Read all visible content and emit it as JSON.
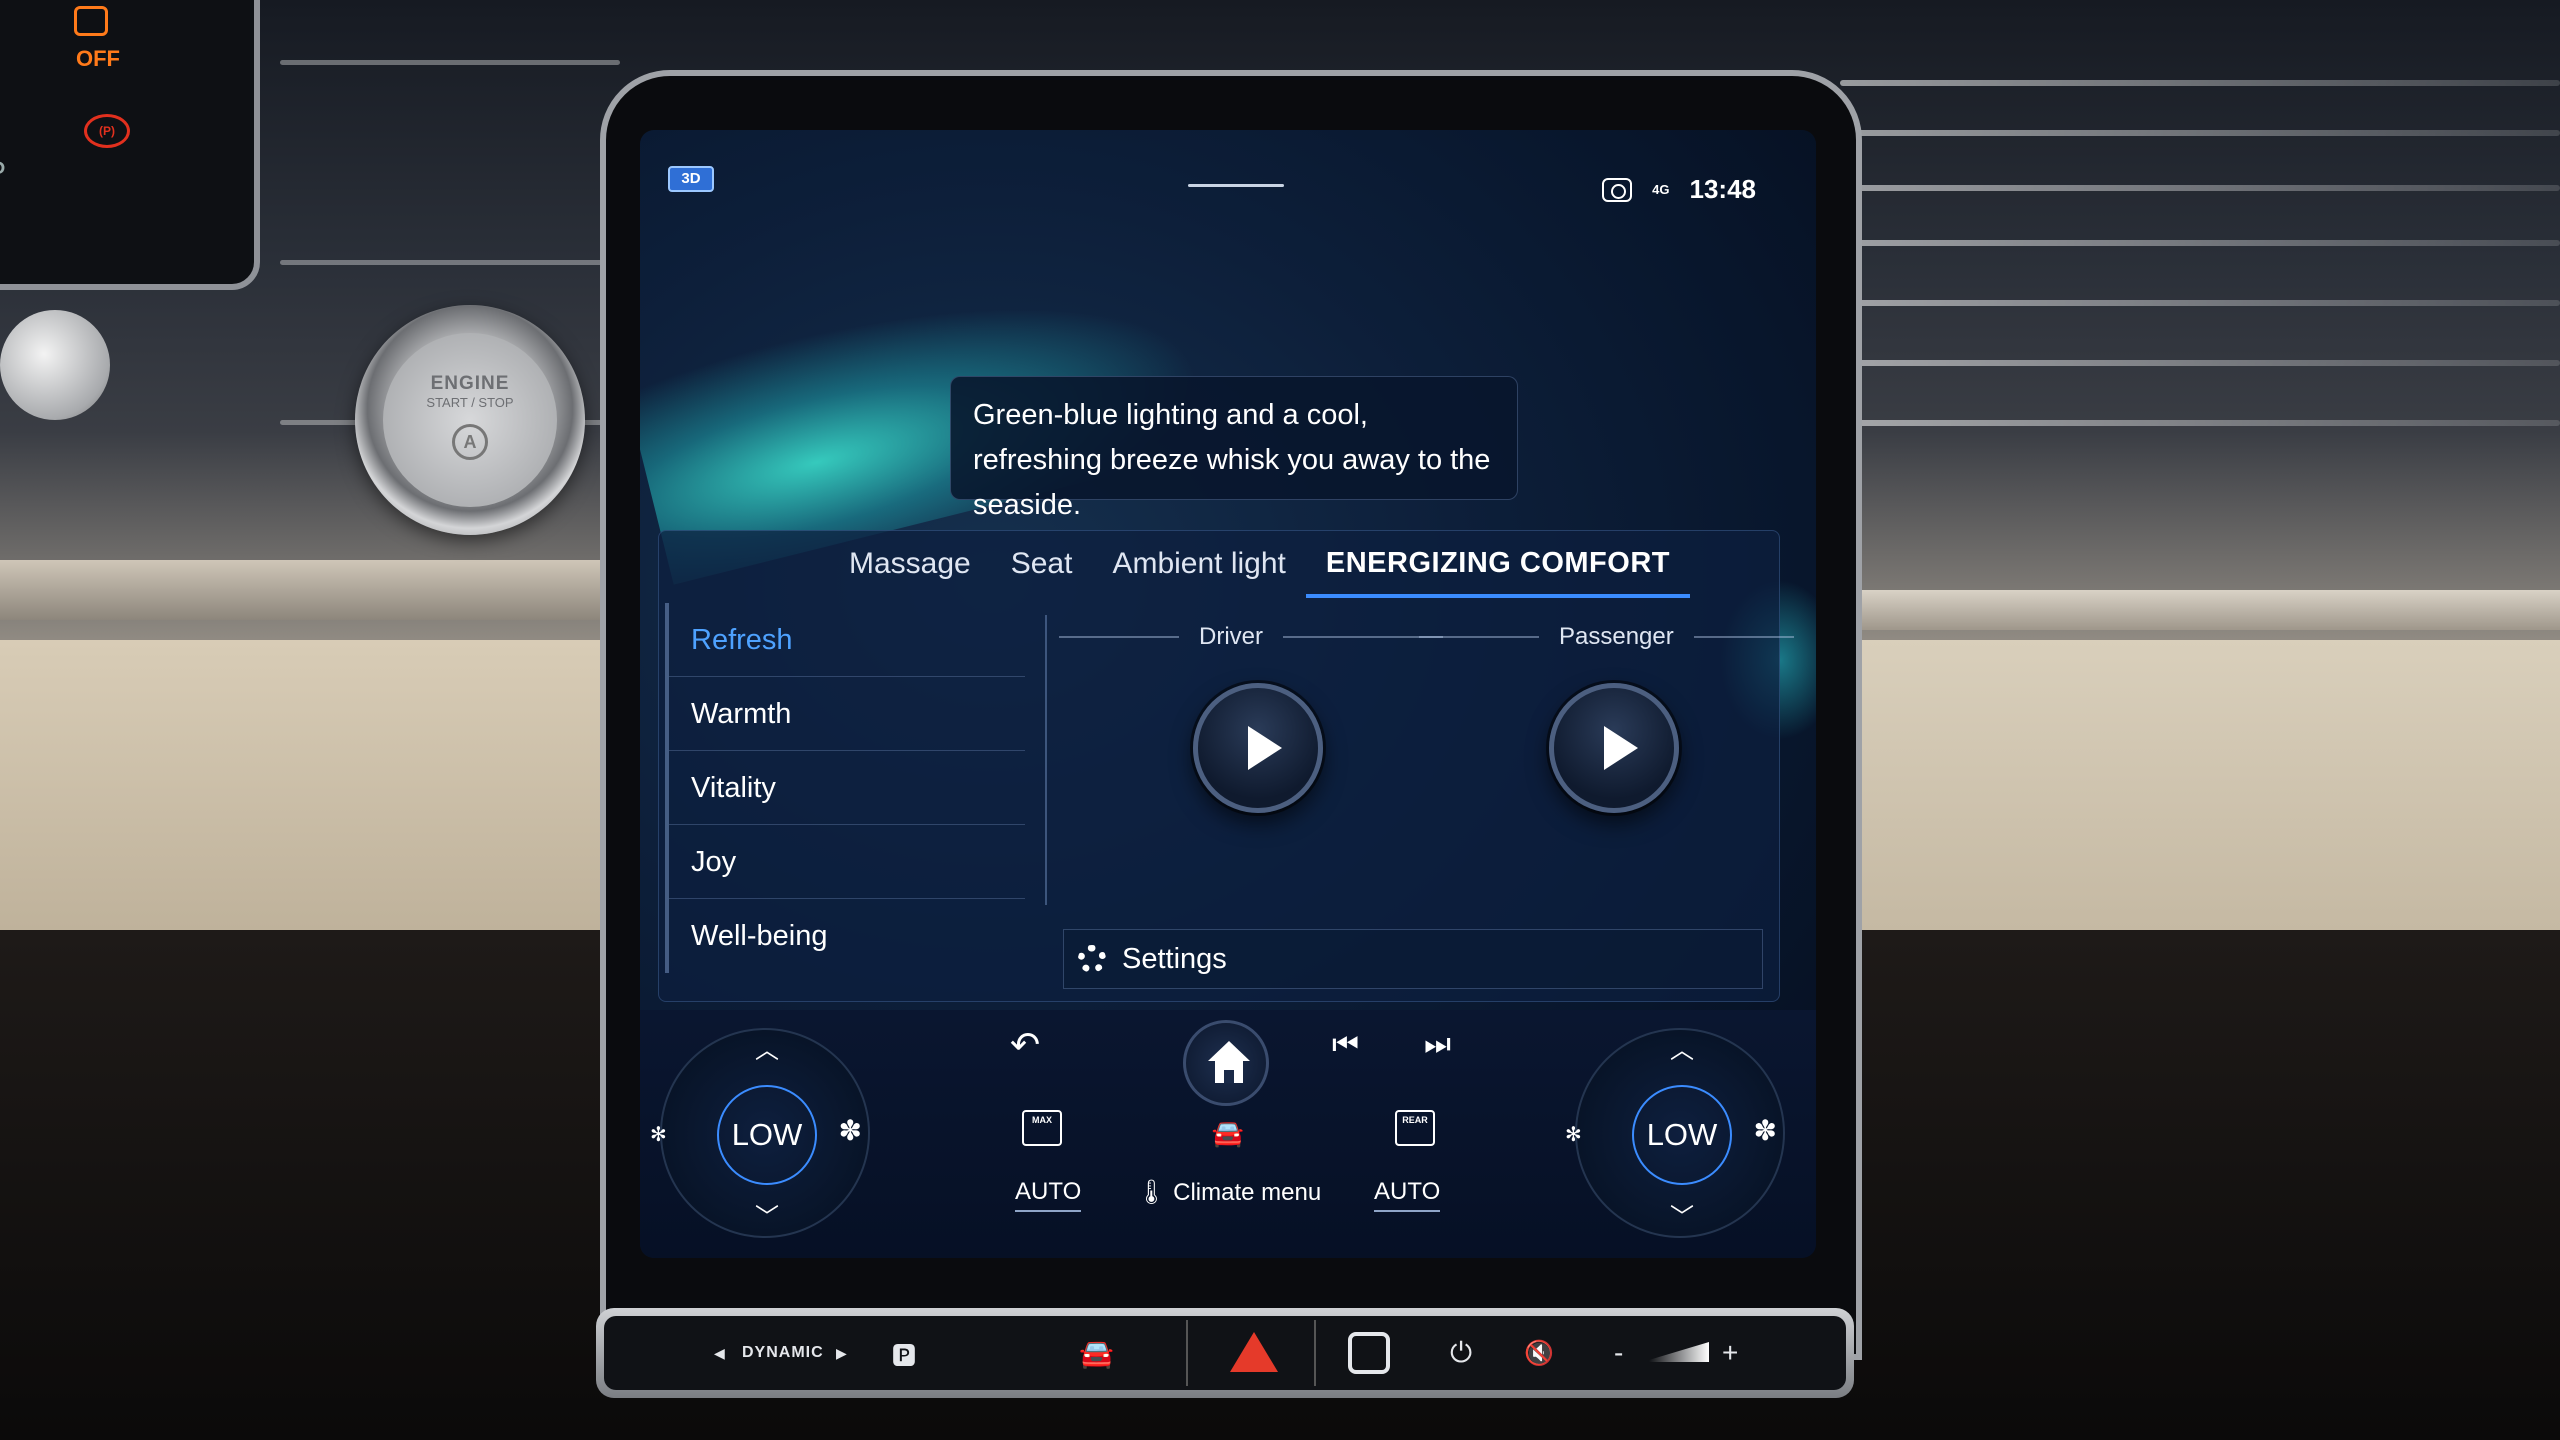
{
  "screen": {
    "badge": "3D",
    "status": {
      "network": "4G",
      "time": "13:48"
    },
    "tooltip": "Green-blue lighting and a cool, refreshing breeze whisk you away to the seaside.",
    "tabs": [
      {
        "label": "Massage",
        "active": false
      },
      {
        "label": "Seat",
        "active": false
      },
      {
        "label": "Ambient light",
        "active": false
      },
      {
        "label": "ENERGIZING COMFORT",
        "active": true
      }
    ],
    "programs": [
      {
        "label": "Refresh",
        "selected": true
      },
      {
        "label": "Warmth",
        "selected": false
      },
      {
        "label": "Vitality",
        "selected": false
      },
      {
        "label": "Joy",
        "selected": false
      },
      {
        "label": "Well-being",
        "selected": false
      }
    ],
    "seats": {
      "driver": "Driver",
      "passenger": "Passenger"
    },
    "settings_label": "Settings"
  },
  "climate": {
    "left_fan": "LOW",
    "right_fan": "LOW",
    "max_label": "MAX",
    "rear_label": "REAR",
    "left_auto": "AUTO",
    "right_auto": "AUTO",
    "climate_menu": "Climate menu"
  },
  "hardware": {
    "drive_mode": "DYNAMIC",
    "volume_minus": "-",
    "volume_plus": "+"
  },
  "cluster": {
    "off_label": "OFF",
    "gear": "P"
  },
  "engine_button": {
    "line1": "ENGINE",
    "line2": "START / STOP",
    "auto_symbol": "A"
  },
  "colors": {
    "accent": "#3b8cff",
    "selected_item": "#4ea2ff",
    "hazard": "#e53a2a",
    "cluster_warning": "#ff7a1a"
  }
}
